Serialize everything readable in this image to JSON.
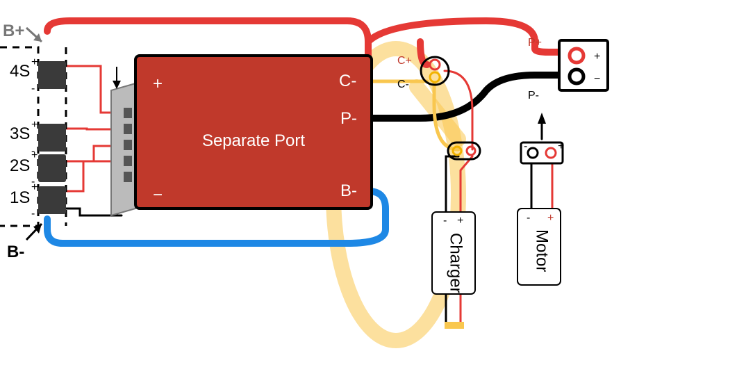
{
  "diagram": {
    "title": "Separate Port",
    "b_plus": "B+",
    "b_minus": "B-",
    "cells": {
      "c1": "1S",
      "c2": "2S",
      "c3": "3S",
      "c4": "4S"
    },
    "bms": {
      "plus": "+",
      "minus": "−",
      "p_minus": "P-",
      "b_minus": "B-",
      "c_minus": "C-"
    },
    "conn_c_plus": "C+",
    "conn_c_minus": "C-",
    "conn_p_plus": "P+",
    "conn_p_minus": "P-",
    "output": {
      "plus": "+",
      "minus": "−"
    },
    "charger": {
      "name": "Charger",
      "plus": "+",
      "minus": "-"
    },
    "motor": {
      "name": "Motor",
      "plus": "+",
      "minus": "-"
    }
  }
}
